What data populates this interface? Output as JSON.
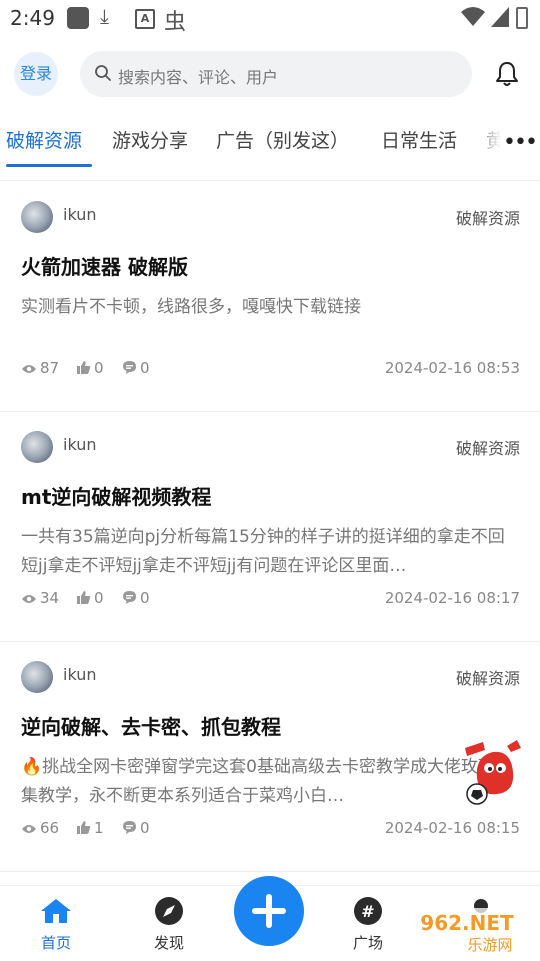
{
  "status_bar": {
    "time": "2:49"
  },
  "header": {
    "login_label": "登录",
    "search_placeholder": "搜索内容、评论、用户"
  },
  "tabs": [
    {
      "label": "破解资源",
      "active": true
    },
    {
      "label": "游戏分享"
    },
    {
      "label": "广告（别发这）"
    },
    {
      "label": "日常生活"
    },
    {
      "label": "黄"
    }
  ],
  "more_label": "•••",
  "posts": [
    {
      "author": "ikun",
      "category": "破解资源",
      "title": "火箭加速器 破解版",
      "excerpt": "实测看片不卡顿，线路很多，嘎嘎快下载链接",
      "views": "87",
      "likes": "0",
      "comments": "0",
      "date": "2024-02-16 08:53"
    },
    {
      "author": "ikun",
      "category": "破解资源",
      "title": "mt逆向破解视频教程",
      "excerpt": "一共有35篇逆向pj分析每篇15分钟的样子讲的挺详细的拿走不回短jj拿走不评短jj拿走不评短jj有问题在评论区里面…",
      "views": "34",
      "likes": "0",
      "comments": "0",
      "date": "2024-02-16 08:17"
    },
    {
      "author": "ikun",
      "category": "破解资源",
      "title": "逆向破解、去卡密、抓包教程",
      "excerpt": "🔥挑战全网卡密弹窗学完这套0基础高级去卡密教学成大佬玫瑰合集教学，永不断更本系列适合于菜鸡小白…",
      "views": "66",
      "likes": "1",
      "comments": "0",
      "date": "2024-02-16 08:15"
    }
  ],
  "bottom_nav": [
    {
      "label": "首页",
      "icon": "home-icon",
      "active": true
    },
    {
      "label": "发现",
      "icon": "compass-icon"
    },
    {
      "label": "广场",
      "icon": "hashtag-icon"
    },
    {
      "label": "",
      "icon": "profile-icon"
    }
  ],
  "watermark": {
    "line1": "962.NET",
    "line2": "乐游网"
  },
  "colors": {
    "accent": "#1c70d8",
    "fab": "#1a84f0"
  }
}
